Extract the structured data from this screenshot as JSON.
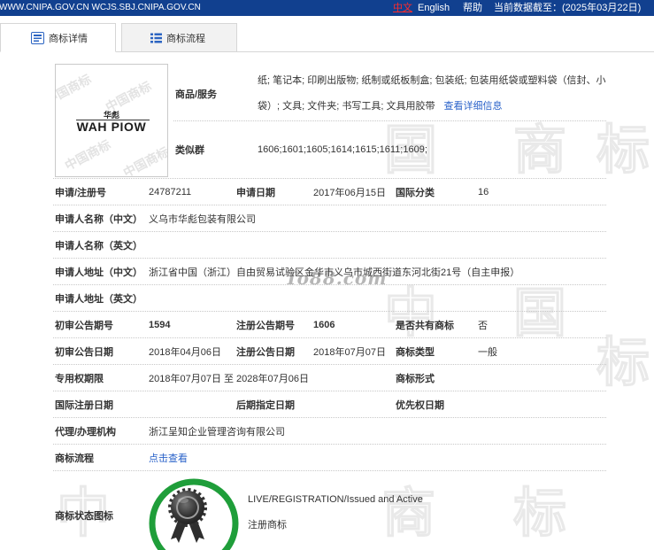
{
  "topbar": {
    "domains": "WWW.CNIPA.GOV.CN WCJS.SBJ.CNIPA.GOV.CN",
    "lang_zh": "中文",
    "lang_en": "English",
    "help": "帮助",
    "data_as_of": "当前数据截至：(2025年03月22日)"
  },
  "tabs": [
    {
      "label": "商标详情",
      "icon": "document-icon",
      "active": true
    },
    {
      "label": "商标流程",
      "icon": "list-icon",
      "active": false
    }
  ],
  "trademark_image": {
    "name_cn": "华彪",
    "name_en": "WAH PIOW",
    "watermark": "中国商标"
  },
  "goods_services": {
    "label": "商品/服务",
    "value": "纸; 笔记本; 印刷出版物; 纸制或纸板制盒; 包装纸; 包装用纸袋或塑料袋（信封、小袋）; 文具; 文件夹; 书写工具; 文具用胶带",
    "detail_link": "查看详细信息"
  },
  "similar_groups": {
    "label": "类似群",
    "value": "1606;1601;1605;1614;1615;1611;1609;"
  },
  "fields": {
    "reg_no": {
      "label": "申请/注册号",
      "value": "24787211"
    },
    "app_date": {
      "label": "申请日期",
      "value": "2017年06月15日"
    },
    "intl_class": {
      "label": "国际分类",
      "value": "16"
    },
    "applicant_cn": {
      "label": "申请人名称（中文）",
      "value": "义乌市华彪包装有限公司"
    },
    "applicant_en": {
      "label": "申请人名称（英文）"
    },
    "address_cn": {
      "label": "申请人地址（中文）",
      "value": "浙江省中国（浙江）自由贸易试验区金华市义乌市城西街道东河北街21号（自主申报）"
    },
    "address_en": {
      "label": "申请人地址（英文）"
    },
    "prelim_pub_no": {
      "label": "初审公告期号",
      "value": "1594"
    },
    "reg_pub_no": {
      "label": "注册公告期号",
      "value": "1606"
    },
    "shared": {
      "label": "是否共有商标",
      "value": "否"
    },
    "prelim_pub_date": {
      "label": "初审公告日期",
      "value": "2018年04月06日"
    },
    "reg_pub_date": {
      "label": "注册公告日期",
      "value": "2018年07月07日"
    },
    "tm_type": {
      "label": "商标类型",
      "value": "一般"
    },
    "exclusive_term": {
      "label": "专用权期限",
      "value": "2018年07月07日 至 2028年07月06日"
    },
    "tm_form": {
      "label": "商标形式"
    },
    "intl_reg_date": {
      "label": "国际注册日期"
    },
    "later_designation_date": {
      "label": "后期指定日期"
    },
    "priority_date": {
      "label": "优先权日期"
    },
    "agency": {
      "label": "代理/办理机构",
      "value": "浙江呈知企业管理咨询有限公司"
    },
    "process": {
      "label": "商标流程",
      "value": "点击查看"
    }
  },
  "status": {
    "label": "商标状态图标",
    "icon": "registered-medal-icon",
    "text_en": "LIVE/REGISTRATION/Issued and Active",
    "text_cn": "注册商标"
  },
  "watermark": {
    "site": "To88.com",
    "chars": [
      "中",
      "国",
      "商",
      "标"
    ]
  },
  "colors": {
    "topbar_bg": "#11408f",
    "lang_active": "#ff2b2b",
    "link": "#2a62c9",
    "status_ring": "#1f9e3a",
    "icon_blue": "#2b64c2"
  }
}
